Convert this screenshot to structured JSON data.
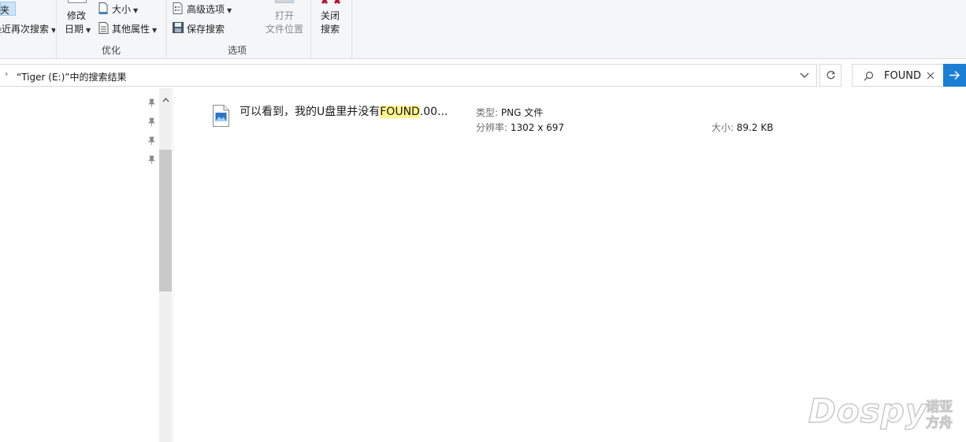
{
  "ribbon": {
    "left_partial_top": "夹",
    "left_partial_bottom": "搜索",
    "left_partial_bottom_prefix": "最近再次",
    "modify_top": "修改",
    "modify_bottom": "日期",
    "size": "大小",
    "other_props": "其他属性",
    "group_optimize": "优化",
    "advanced_options": "高级选项",
    "save_search": "保存搜索",
    "open_top": "打开",
    "open_bottom": "文件位置",
    "group_options": "选项",
    "close_top": "关闭",
    "close_bottom": "搜索"
  },
  "address": {
    "path": "“Tiger (E:)”中的搜索结果"
  },
  "search": {
    "value": "FOUND"
  },
  "results": [
    {
      "name_before": "可以看到，我的U盘里并没有",
      "name_highlight": "FOUND",
      "name_after": ".00...",
      "type_label": "类型:",
      "type_value": "PNG 文件",
      "resolution_label": "分辨率:",
      "resolution_value": "1302 x 697",
      "size_label": "大小:",
      "size_value": "89.2 KB"
    }
  ],
  "watermark": {
    "text": "Dospy",
    "cn_line1": "诺亚",
    "cn_line2": "方舟"
  },
  "colors": {
    "accent": "#1a7fd4",
    "highlight": "#fff68f",
    "close_icon": "#b3102a"
  }
}
